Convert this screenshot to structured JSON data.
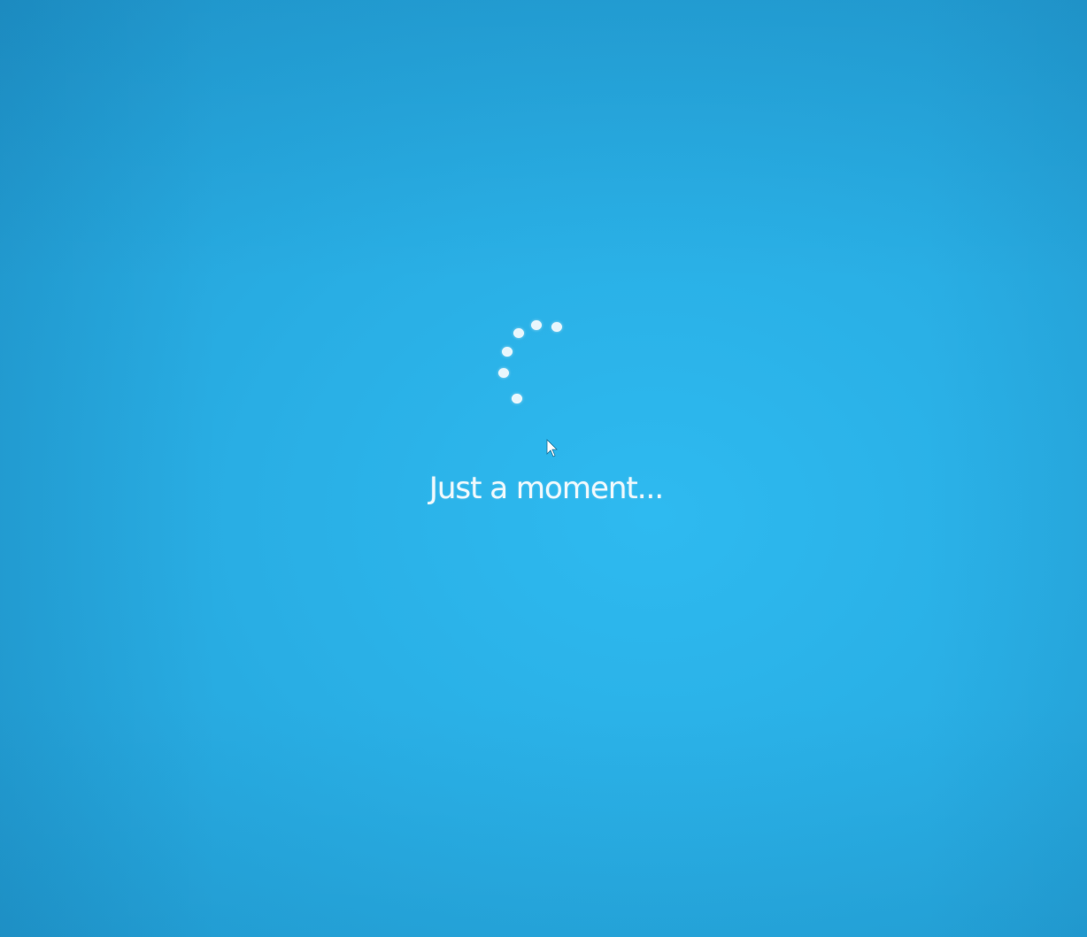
{
  "screen": {
    "background_color": "#2aade3",
    "message": "Just a moment..."
  },
  "spinner": {
    "icon": "loading-spinner-icon"
  },
  "cursor": {
    "icon": "mouse-pointer-icon"
  }
}
